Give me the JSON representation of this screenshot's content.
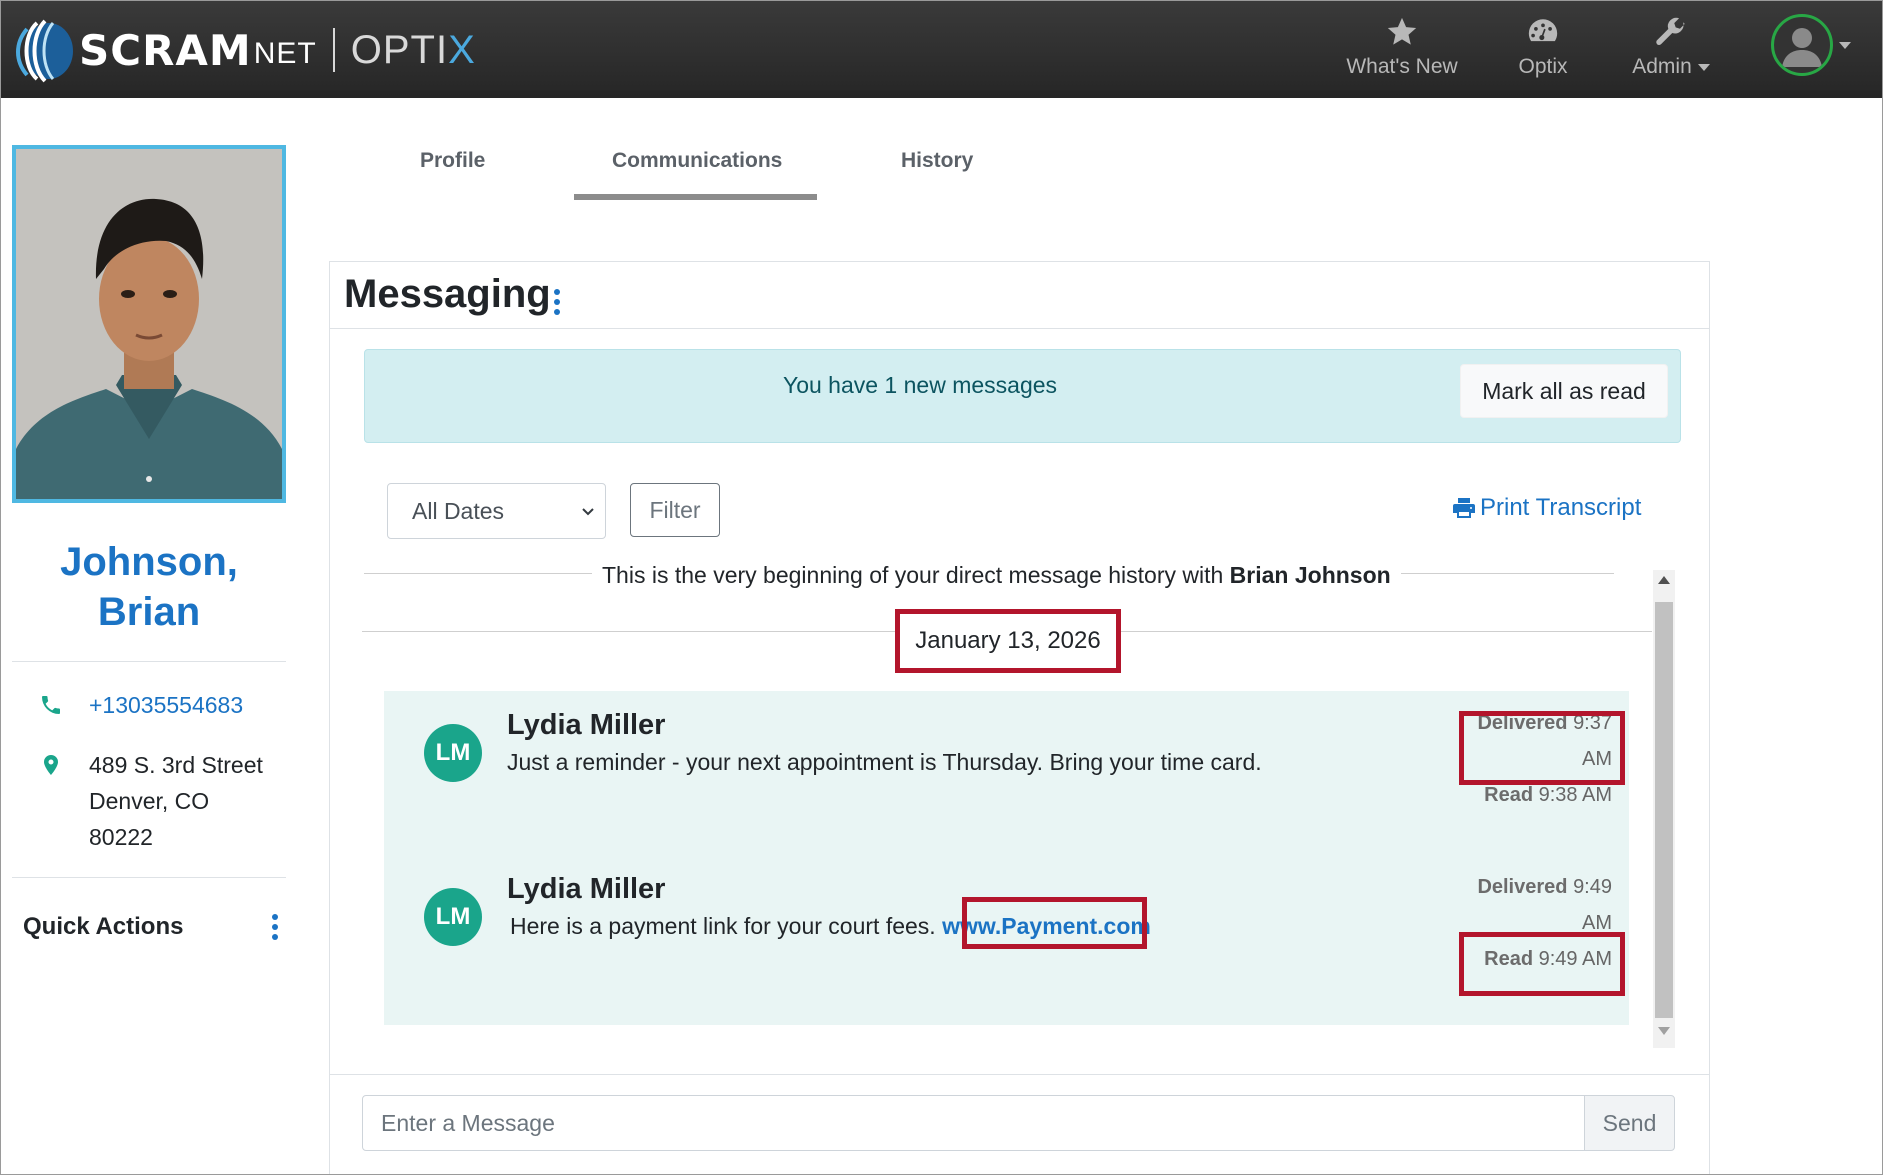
{
  "app": {
    "brand_primary": "SCRAM",
    "brand_secondary": "NET",
    "product_name": "OPTI",
    "product_name_suffix": "X"
  },
  "navbar": {
    "items": [
      {
        "label": "What's New",
        "icon": "star-icon"
      },
      {
        "label": "Optix",
        "icon": "dashboard-icon"
      },
      {
        "label": "Admin",
        "icon": "wrench-icon"
      }
    ],
    "user_icon": "user-avatar-icon"
  },
  "sidebar": {
    "name_line1": "Johnson,",
    "name_line2": "Brian",
    "phone": "+13035554683",
    "address_line1": "489 S. 3rd Street",
    "address_line2": "Denver, CO",
    "address_line3": "80222",
    "quick_actions": "Quick Actions"
  },
  "tabs": [
    {
      "label": "Profile",
      "active": false
    },
    {
      "label": "Communications",
      "active": true
    },
    {
      "label": "History",
      "active": false
    }
  ],
  "messaging": {
    "title": "Messaging",
    "alert_text": "You have 1 new messages",
    "mark_all_read": "Mark all as read",
    "date_filter_selected": "All Dates",
    "filter_button": "Filter",
    "print_transcript": "Print Transcript",
    "history_prefix": "This is the very beginning of your direct message history with ",
    "history_name": "Brian Johnson",
    "date_divider": "January 13, 2026",
    "messages": [
      {
        "initials": "LM",
        "sender": "Lydia Miller",
        "text": "Just a reminder - your next appointment is Thursday. Bring your time card.",
        "link": "",
        "delivered_label": "Delivered",
        "delivered_time_1": "9:37",
        "delivered_time_2": "AM",
        "read_label": "Read",
        "read_time": "9:38 AM"
      },
      {
        "initials": "LM",
        "sender": "Lydia Miller",
        "text": "Here is a payment link for your court fees.",
        "link": "www.Payment.com",
        "delivered_label": "Delivered",
        "delivered_time_1": "9:49",
        "delivered_time_2": "AM",
        "read_label": "Read",
        "read_time": "9:49 AM"
      }
    ],
    "composer_placeholder": "Enter a Message",
    "send_button": "Send"
  },
  "colors": {
    "navbar": "#2b2b2b",
    "accent_blue": "#1b73c4",
    "avatar_green": "#1aa58b",
    "highlight_red": "#b3152c",
    "alert_bg": "#d3eef1",
    "thread_bg": "#e9f5f4"
  }
}
